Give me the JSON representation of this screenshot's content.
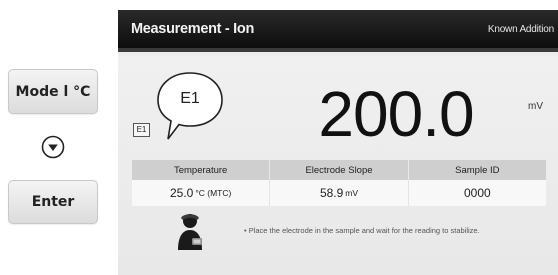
{
  "hardware_buttons": {
    "mode_label": "Mode l °C",
    "arrow_icon": "down-arrow-circle-icon",
    "enter_label": "Enter"
  },
  "screen": {
    "title": "Measurement - Ion",
    "mode": "Known Addition",
    "bubble_label": "E1",
    "electrode_tag": "E1",
    "reading_value": "200.0",
    "reading_unit": "mV"
  },
  "table": {
    "headers": [
      "Temperature",
      "Electrode Slope",
      "Sample ID"
    ],
    "temperature_value": "25.0",
    "temperature_unit": "°C (MTC)",
    "slope_value": "58.9",
    "slope_unit": "mV",
    "sample_id": "0000"
  },
  "instruction": {
    "icon": "person-icon",
    "text": "• Place the electrode in the sample and wait for the reading to stabilize."
  }
}
